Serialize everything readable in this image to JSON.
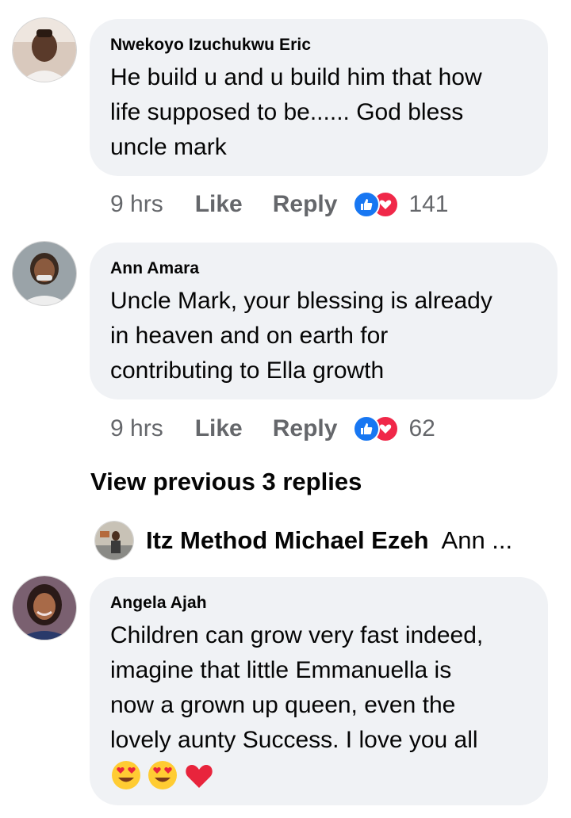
{
  "comments": [
    {
      "author": "Nwekoyo Izuchukwu Eric",
      "lines": [
        "He build u and u build him that how",
        "life supposed to be...... God bless",
        "uncle mark"
      ],
      "time": "9 hrs",
      "like_label": "Like",
      "reply_label": "Reply",
      "reaction_count": "141",
      "reaction_icons": [
        "like-reaction-icon",
        "love-reaction-icon"
      ]
    },
    {
      "author": "Ann Amara",
      "lines": [
        "Uncle Mark, your blessing is already",
        "in heaven and on earth for",
        "contributing to Ella growth"
      ],
      "time": "9 hrs",
      "like_label": "Like",
      "reply_label": "Reply",
      "reaction_count": "62",
      "reaction_icons": [
        "like-reaction-icon",
        "love-reaction-icon"
      ]
    },
    {
      "author": "Angela Ajah",
      "lines": [
        "Children can grow very fast indeed,",
        "imagine that little Emmanuella is",
        "now a grown up queen, even the",
        "lovely aunty Success. I love you all"
      ],
      "emojis": [
        "heart-eyes-emoji",
        "heart-eyes-emoji",
        "red-heart-emoji"
      ]
    }
  ],
  "view_previous": "View previous 3 replies",
  "latest_reply": {
    "author": "Itz Method Michael Ezeh",
    "snippet": "Ann ..."
  },
  "colors": {
    "bubble": "#f0f2f5",
    "meta": "#65676b",
    "like_blue": "#1877f2",
    "love_red": "#f02849"
  }
}
